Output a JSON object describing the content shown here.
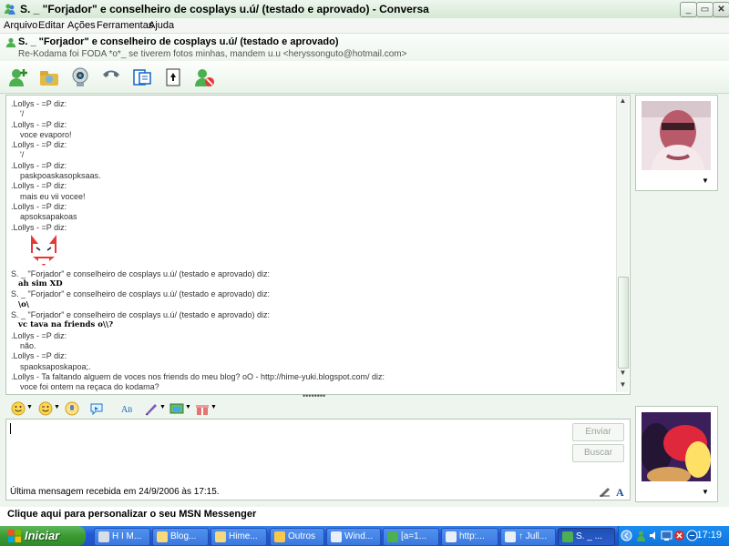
{
  "window": {
    "title": "S. _ \"Forjador\" e conselheiro de cosplays u.ú/ (testado e aprovado) - Conversa"
  },
  "menu": [
    "Arquivo",
    "Editar",
    "Ações",
    "Ferramentas",
    "Ajuda"
  ],
  "header": {
    "contact_name": "S. _ \"Forjador\" e conselheiro de cosplays u.ú/ (testado e aprovado)",
    "contact_sub": "Re-Kodama foi FODA *o*_ se tiverem fotos minhas, mandem u.u <heryssonguto@hotmail.com>"
  },
  "toolbar_icons": [
    "invite-contact-icon",
    "send-files-icon",
    "webcam-icon",
    "call-icon",
    "activities-icon",
    "games-icon",
    "block-icon"
  ],
  "history": {
    "lines": [
      {
        "type": "head",
        "text": ".Lollys - =P diz:"
      },
      {
        "type": "msg",
        "text": "'/"
      },
      {
        "type": "head",
        "text": ".Lollys - =P diz:"
      },
      {
        "type": "msg",
        "text": "voce evaporo!"
      },
      {
        "type": "head",
        "text": ".Lollys - =P diz:"
      },
      {
        "type": "msg",
        "text": "'/"
      },
      {
        "type": "head",
        "text": ".Lollys - =P diz:"
      },
      {
        "type": "msg",
        "text": "paskpoaskasopksaas."
      },
      {
        "type": "head",
        "text": ".Lollys - =P diz:"
      },
      {
        "type": "msg",
        "text": "mais eu vii vocee!"
      },
      {
        "type": "head",
        "text": ".Lollys - =P diz:"
      },
      {
        "type": "msg",
        "text": "apsoksapakoas"
      },
      {
        "type": "head",
        "text": ".Lollys - =P diz:"
      },
      {
        "type": "emoticon",
        "text": ""
      },
      {
        "type": "head",
        "text": "S. _ \"Forjador\" e conselheiro de cosplays u.ú/ (testado e aprovado) diz:"
      },
      {
        "type": "bold",
        "text": "ah sim XD"
      },
      {
        "type": "head",
        "text": "S. _ \"Forjador\" e conselheiro de cosplays u.ú/ (testado e aprovado) diz:"
      },
      {
        "type": "bold",
        "text": "\\o\\"
      },
      {
        "type": "head",
        "text": "S. _ \"Forjador\" e conselheiro de cosplays u.ú/ (testado e aprovado) diz:"
      },
      {
        "type": "bold",
        "text": "vc tava na friends o\\\\?"
      },
      {
        "type": "head",
        "text": ".Lollys - =P diz:"
      },
      {
        "type": "msg",
        "text": "não."
      },
      {
        "type": "head",
        "text": ".Lollys - =P diz:"
      },
      {
        "type": "msg",
        "text": "spaoksaposkapoa;."
      },
      {
        "type": "head",
        "text": ".Lollys - Ta faltando alguem de voces nos friends do meu blog? oO - http://hime-yuki.blogspot.com/ diz:"
      },
      {
        "type": "msg",
        "text": "voce foi ontem na reçaca do kodama?"
      }
    ]
  },
  "compose": {
    "send_label": "Enviar",
    "search_label": "Buscar"
  },
  "status": {
    "last_message": "Última mensagem recebida em 24/9/2006 às 17:15."
  },
  "personalize_link": "Clique aqui para personalizar o seu MSN Messenger",
  "taskbar": {
    "start_label": "Iniciar",
    "tasks": [
      "H I M...",
      "Blog...",
      "Hime...",
      "Outros",
      "Wind...",
      "[a=1...",
      "http:...",
      "↑ Jull...",
      "S. _ ..."
    ],
    "clock": "17:19"
  },
  "colors": {
    "accent": "#2459d6",
    "start_green": "#3b9a34",
    "window_tint": "#eef5ee"
  }
}
